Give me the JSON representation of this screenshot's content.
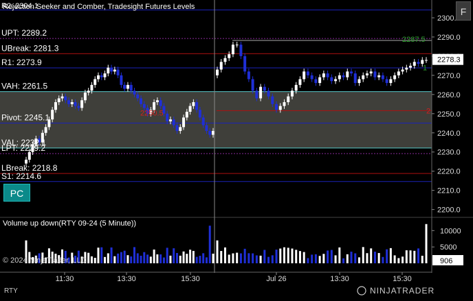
{
  "title": "Rejection Seeker and Comber, Tradesight Futures Levels",
  "title_overlay": "R2: 2304.1",
  "instrument_label": "RTY",
  "copyright": "© 2024 NinjaTrader, LLC",
  "brand": "NINJATRADER",
  "pc_button": "PC",
  "f_button": "F",
  "volume_panel_title": "Volume up down(RTY 09-24 (5 Minute))",
  "colors": {
    "background": "#000000",
    "up_candle": "#ffffff",
    "down_candle": "#1f2fd6",
    "value_area_fill": "#3f3f3a",
    "teal_line": "#58c8c8",
    "red_line": "#b01010",
    "blue_line": "#1a22b8",
    "purple_dotted": "#8a2a9a",
    "green_text": "#2aa02a"
  },
  "levels": [
    {
      "label": "R2: 2304.1",
      "value": 2304.1,
      "color": "#1a22b8",
      "style": "solid"
    },
    {
      "label": "UPT: 2289.2",
      "value": 2289.2,
      "color": "#8a2a9a",
      "style": "dotted"
    },
    {
      "label": "UBreak: 2281.3",
      "value": 2281.3,
      "color": "#b01010",
      "style": "solid"
    },
    {
      "label": "R1: 2273.9",
      "value": 2273.9,
      "color": "#1a22b8",
      "style": "solid"
    },
    {
      "label": "VAH: 2261.5",
      "value": 2261.5,
      "color": "#58c8c8",
      "style": "solid"
    },
    {
      "label": "Pivot: 2245.1",
      "value": 2245.1,
      "color": "#1a22b8",
      "style": "solid"
    },
    {
      "label": "VAL: 2232.1",
      "value": 2232.1,
      "color": "#58c8c8",
      "style": "solid"
    },
    {
      "label": "LPT: 2229.2",
      "value": 2229.2,
      "color": "#8a2a9a",
      "style": "dotted"
    },
    {
      "label": "LBreak: 2218.8",
      "value": 2218.8,
      "color": "#b01010",
      "style": "solid"
    },
    {
      "label": "S1: 2214.6",
      "value": 2214.6,
      "color": "#1a22b8",
      "style": "solid"
    }
  ],
  "annotations": [
    {
      "text": "2287.5",
      "color": "#2aa02a"
    },
    {
      "text": "2250.5",
      "color": "#d02020"
    },
    {
      "text": "2",
      "color": "#d02020"
    },
    {
      "text": "1",
      "color": "#2aa02a"
    }
  ],
  "last_price": "2278.3",
  "last_volume": "906",
  "chart_data": {
    "type": "candlestick",
    "y_axis": {
      "ticks": [
        "2300.0",
        "2290.0",
        "2280.0",
        "2270.0",
        "2260.0",
        "2250.0",
        "2240.0",
        "2230.0",
        "2220.0",
        "2210.0",
        "2200.0"
      ],
      "range": [
        2197,
        2305
      ]
    },
    "x_axis": {
      "ticks": [
        "11:30",
        "13:30",
        "15:30",
        "Jul 26",
        "13:30",
        "15:30"
      ]
    },
    "volume_axis": {
      "ticks": [
        "10000",
        "5000"
      ]
    },
    "closes": [
      2226,
      2230,
      2234,
      2237,
      2235,
      2240,
      2243,
      2247,
      2252,
      2256,
      2258,
      2259,
      2257,
      2255,
      2256,
      2254,
      2253,
      2257,
      2261,
      2262,
      2265,
      2268,
      2270,
      2269,
      2271,
      2274,
      2272,
      2273,
      2270,
      2265,
      2263,
      2265,
      2262,
      2260,
      2258,
      2255,
      2253,
      2250,
      2252,
      2256,
      2257,
      2254,
      2250,
      2246,
      2247,
      2244,
      2241,
      2243,
      2248,
      2251,
      2254,
      2256,
      2252,
      2248,
      2244,
      2241,
      2239,
      2241,
      2273,
      2277,
      2279,
      2281,
      2286,
      2286,
      2280,
      2272,
      2268,
      2262,
      2258,
      2264,
      2262,
      2259,
      2255,
      2252,
      2254,
      2256,
      2259,
      2262,
      2265,
      2268,
      2272,
      2270,
      2268,
      2266,
      2269,
      2271,
      2269,
      2267,
      2268,
      2270,
      2269,
      2272,
      2271,
      2266,
      2268,
      2270,
      2271,
      2272,
      2269,
      2270,
      2268,
      2266,
      2268,
      2270,
      2272,
      2273,
      2274,
      2275,
      2277,
      2276,
      2278,
      2278
    ]
  }
}
